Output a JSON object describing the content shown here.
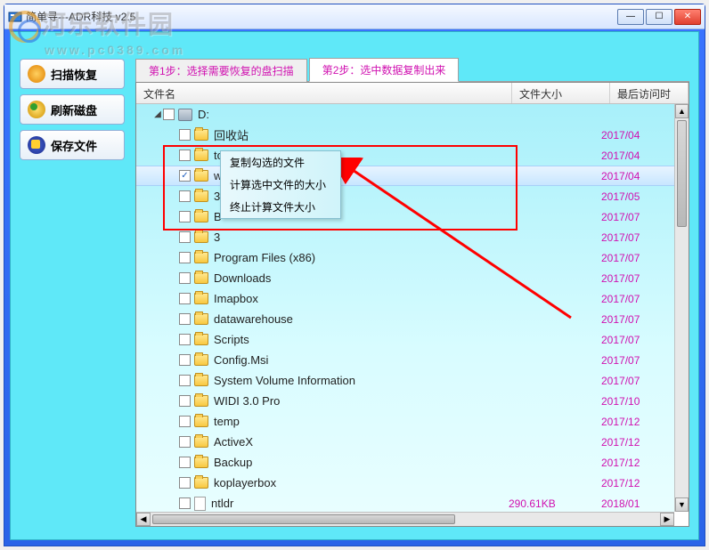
{
  "window": {
    "title": "简单寻---ADR科技 v2.5"
  },
  "watermark": {
    "text": "河乐软件园",
    "sub": "www.pc0389.com"
  },
  "sidebar": [
    {
      "label": "扫描恢复"
    },
    {
      "label": "刷新磁盘"
    },
    {
      "label": "保存文件"
    }
  ],
  "tabs": [
    {
      "label": "第1步：选择需要恢复的盘扫描",
      "active": false
    },
    {
      "label": "第2步：选中数据复制出来",
      "active": true
    }
  ],
  "columns": {
    "name": "文件名",
    "size": "文件大小",
    "date": "最后访问时"
  },
  "drive": {
    "label": "D:"
  },
  "rows": [
    {
      "name": "回收站",
      "size": "",
      "date": "2017/04",
      "icon": "folder",
      "checked": false
    },
    {
      "name": "tools",
      "size": "",
      "date": "2017/04",
      "icon": "folder",
      "checked": false
    },
    {
      "name": "win",
      "size": "",
      "date": "2017/04",
      "icon": "folder",
      "checked": true,
      "selected": true
    },
    {
      "name": "3",
      "size": "",
      "date": "2017/05",
      "icon": "folder",
      "checked": false
    },
    {
      "name": "B",
      "size": "",
      "date": "2017/07",
      "icon": "folder",
      "checked": false
    },
    {
      "name": "3",
      "size": "",
      "date": "2017/07",
      "icon": "folder",
      "checked": false
    },
    {
      "name": "Program Files (x86)",
      "size": "",
      "date": "2017/07",
      "icon": "folder",
      "checked": false
    },
    {
      "name": "Downloads",
      "size": "",
      "date": "2017/07",
      "icon": "folder",
      "checked": false
    },
    {
      "name": "Imapbox",
      "size": "",
      "date": "2017/07",
      "icon": "folder",
      "checked": false
    },
    {
      "name": "datawarehouse",
      "size": "",
      "date": "2017/07",
      "icon": "folder",
      "checked": false
    },
    {
      "name": "Scripts",
      "size": "",
      "date": "2017/07",
      "icon": "folder",
      "checked": false
    },
    {
      "name": "Config.Msi",
      "size": "",
      "date": "2017/07",
      "icon": "folder",
      "checked": false
    },
    {
      "name": "System Volume Information",
      "size": "",
      "date": "2017/07",
      "icon": "folder",
      "checked": false
    },
    {
      "name": "WIDI 3.0 Pro",
      "size": "",
      "date": "2017/10",
      "icon": "folder",
      "checked": false
    },
    {
      "name": "temp",
      "size": "",
      "date": "2017/12",
      "icon": "folder",
      "checked": false
    },
    {
      "name": "ActiveX",
      "size": "",
      "date": "2017/12",
      "icon": "folder",
      "checked": false
    },
    {
      "name": "Backup",
      "size": "",
      "date": "2017/12",
      "icon": "folder",
      "checked": false
    },
    {
      "name": "koplayerbox",
      "size": "",
      "date": "2017/12",
      "icon": "folder",
      "checked": false
    },
    {
      "name": "ntldr",
      "size": "290.61KB",
      "date": "2018/01",
      "icon": "file",
      "checked": false
    }
  ],
  "context_menu": [
    {
      "label": "复制勾选的文件"
    },
    {
      "label": "计算选中文件的大小"
    },
    {
      "label": "终止计算文件大小"
    }
  ]
}
